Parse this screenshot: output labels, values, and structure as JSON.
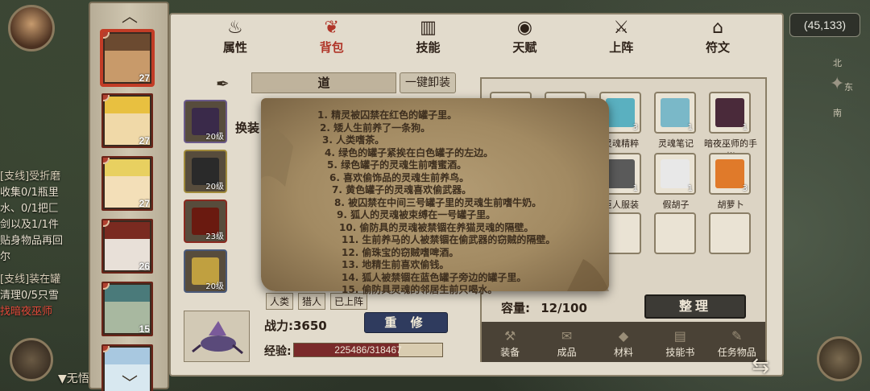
{
  "hud": {
    "coords": "(45,133)",
    "no_quest_label": "▼无悟",
    "compass": {
      "north": "北",
      "east": "东",
      "south": "南"
    },
    "quest_lines": [
      {
        "text": "[支线]受折磨",
        "type": "title"
      },
      {
        "text": "收集0/1瓶里",
        "type": "body"
      },
      {
        "text": "水、0/1把匚",
        "type": "body"
      },
      {
        "text": "剑以及1/1件",
        "type": "body"
      },
      {
        "text": "贴身物品再回",
        "type": "body"
      },
      {
        "text": "尔",
        "type": "body"
      },
      {
        "text": "[支线]装在罐",
        "type": "title"
      },
      {
        "text": "清理0/5只雪",
        "type": "body"
      },
      {
        "text": "找暗夜巫师",
        "type": "highlight"
      }
    ]
  },
  "characters": [
    {
      "level": "27",
      "active": true,
      "colors": [
        "#6b4a30",
        "#c89a6a"
      ]
    },
    {
      "level": "27",
      "active": false,
      "colors": [
        "#e8c040",
        "#f0d9a8"
      ]
    },
    {
      "level": "27",
      "active": false,
      "colors": [
        "#e8d060",
        "#f3dfb8"
      ]
    },
    {
      "level": "26",
      "active": false,
      "colors": [
        "#7a2a20",
        "#e8e0d8"
      ]
    },
    {
      "level": "15",
      "active": false,
      "colors": [
        "#4a7a7a",
        "#a8b8a0"
      ]
    },
    {
      "level": "",
      "active": false,
      "colors": [
        "#a8c8e0",
        "#d8e8f0"
      ]
    }
  ],
  "tabs": [
    {
      "label": "属性",
      "icon": "flame-icon",
      "glyph": "♨",
      "active": false
    },
    {
      "label": "背包",
      "icon": "backpack-icon",
      "glyph": "❦",
      "active": true
    },
    {
      "label": "技能",
      "icon": "book-icon",
      "glyph": "▥",
      "active": false
    },
    {
      "label": "天赋",
      "icon": "eye-icon",
      "glyph": "◉",
      "active": false
    },
    {
      "label": "上阵",
      "icon": "crossed-swords-icon",
      "glyph": "⚔",
      "active": false
    },
    {
      "label": "符文",
      "icon": "house-icon",
      "glyph": "⌂",
      "active": false
    }
  ],
  "equipment": {
    "section_title": "道",
    "unequip_all": "一键卸装",
    "swap_label": "换装",
    "slots": [
      {
        "level": "20级",
        "border": "#6b5a8a",
        "art": "#3a2a4a"
      },
      {
        "level": "20级",
        "border": "#a08a3a",
        "art": "#2a2a2a"
      },
      {
        "level": "23级",
        "border": "#8a2a20",
        "art": "#6a1a10"
      },
      {
        "level": "20级",
        "border": "#4a5a7a",
        "art": "#c0a040"
      }
    ],
    "tags": [
      "人类",
      "猎人",
      "已上阵"
    ],
    "power": "战力:3650",
    "repair": "重 修",
    "exp_label": "经验:",
    "exp_text": "225486/318467",
    "exp_current": 225486,
    "exp_max": 318467
  },
  "inventory": {
    "slots_row1": [
      {
        "label": "",
        "count": "",
        "art": "#b59e76"
      },
      {
        "label": "",
        "count": "",
        "art": "#6a8a8a"
      },
      {
        "label": "灵魂精粹",
        "count": "3",
        "art": "#5ab0c0"
      },
      {
        "label": "灵魂笔记",
        "count": "1",
        "art": "#7ab8c8"
      },
      {
        "label": "暗夜巫师的手帐",
        "count": "1",
        "art": "#4a2a3a"
      }
    ],
    "slots_row2": [
      {
        "label": "",
        "count": "",
        "art": "#b59e76"
      },
      {
        "label": "",
        "count": "",
        "art": "#b59e76"
      },
      {
        "label": "巨人服装",
        "count": "1",
        "art": "#5a5a5a"
      },
      {
        "label": "假胡子",
        "count": "1",
        "art": "#e8e8e8"
      },
      {
        "label": "胡萝卜",
        "count": "3",
        "art": "#e07a2a"
      }
    ],
    "capacity_label": "容量:",
    "capacity_value": "12/100",
    "sort_button": "整理",
    "categories": [
      {
        "label": "装备",
        "icon": "hammer-icon",
        "glyph": "⚒"
      },
      {
        "label": "成品",
        "icon": "bag-icon",
        "glyph": "✉"
      },
      {
        "label": "材料",
        "icon": "ore-icon",
        "glyph": "◆"
      },
      {
        "label": "技能书",
        "icon": "scroll-icon",
        "glyph": "▤"
      },
      {
        "label": "任务物品",
        "icon": "quest-letter-icon",
        "glyph": "✎"
      }
    ]
  },
  "parchment": {
    "lines": [
      "1. 精灵被囚禁在红色的罐子里。",
      "2. 矮人生前养了一条狗。",
      "3. 人类嗜茶。",
      "4. 绿色的罐子紧挨在白色罐子的左边。",
      "5. 绿色罐子的灵魂生前嗜蜜酒。",
      "6. 喜欢偷饰品的灵魂生前养鸟。",
      "7. 黄色罐子的灵魂喜欢偷武器。",
      "8. 被囚禁在中间三号罐子里的灵魂生前嗜牛奶。",
      "9. 狐人的灵魂被束缚在一号罐子里。",
      "10. 偷防具的灵魂被禁锢在养猫灵魂的隔壁。",
      "11. 生前养马的人被禁锢在偷武器的窃贼的隔壁。",
      "12. 偷珠宝的窃贼嗜啤酒。",
      "13. 地精生前喜欢偷钱。",
      "14. 狐人被禁锢在蓝色罐子旁边的罐子里。",
      "15. 偷防具灵魂的邻居生前只喝水。"
    ]
  }
}
